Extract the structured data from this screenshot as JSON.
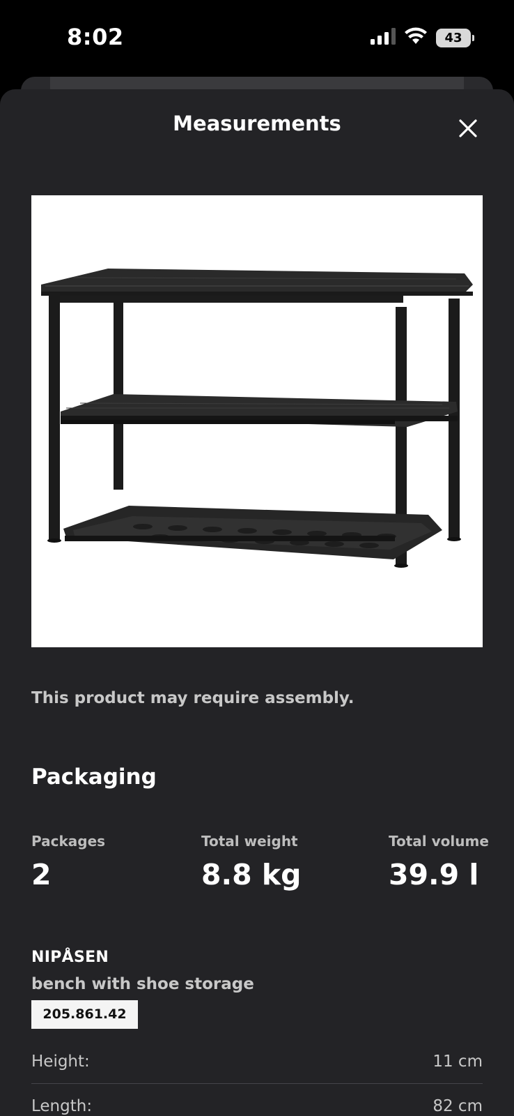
{
  "status_bar": {
    "time": "8:02",
    "battery": "43",
    "icons": [
      "signal-icon",
      "wifi-icon",
      "battery-icon"
    ]
  },
  "sheet": {
    "title": "Measurements",
    "close_icon": "close-icon"
  },
  "product": {
    "image_alt": "bench with shoe storage",
    "assembly_note": "This product may require assembly."
  },
  "packaging": {
    "title": "Packaging",
    "stats": [
      {
        "label": "Packages",
        "value": "2"
      },
      {
        "label": "Total weight",
        "value": "8.8 kg"
      },
      {
        "label": "Total volume",
        "value": "39.9 l"
      }
    ],
    "item": {
      "name": "NIPÅSEN",
      "description": "bench with shoe storage",
      "article_number": "205.861.42"
    },
    "dimensions": [
      {
        "label": "Height:",
        "value": "11 cm"
      },
      {
        "label": "Length:",
        "value": "82 cm"
      }
    ]
  },
  "colors": {
    "background": "#000000",
    "sheet": "#232326",
    "muted_text": "#c8c8c8"
  }
}
